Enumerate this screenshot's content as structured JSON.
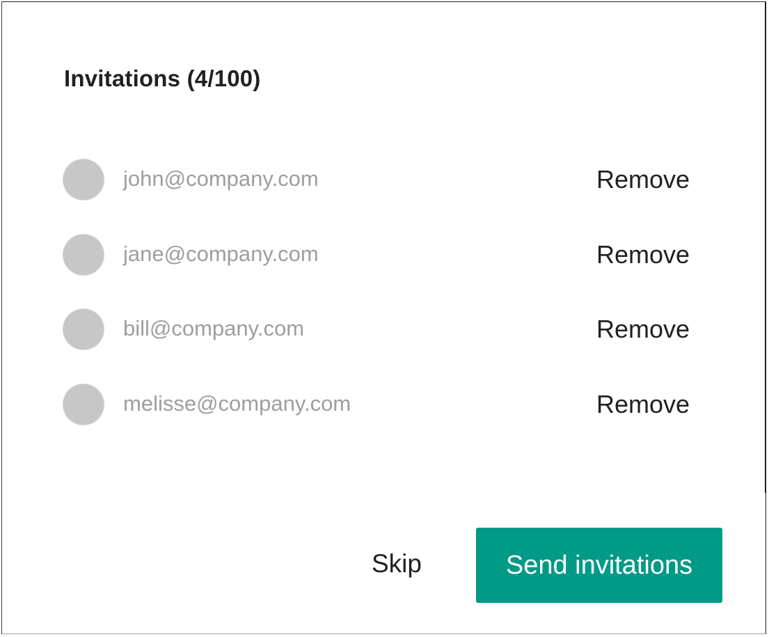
{
  "dialog": {
    "title": "Invitations (4/100)",
    "invitations": [
      {
        "email": "john@company.com",
        "remove_label": "Remove"
      },
      {
        "email": "jane@company.com",
        "remove_label": "Remove"
      },
      {
        "email": "bill@company.com",
        "remove_label": "Remove"
      },
      {
        "email": "melisse@company.com",
        "remove_label": "Remove"
      }
    ],
    "actions": {
      "skip_label": "Skip",
      "send_label": "Send invitations"
    }
  },
  "colors": {
    "accent": "#009a87",
    "avatar_placeholder": "#c7c7c7",
    "email_text": "#9e9e9e",
    "primary_text": "#212121"
  }
}
